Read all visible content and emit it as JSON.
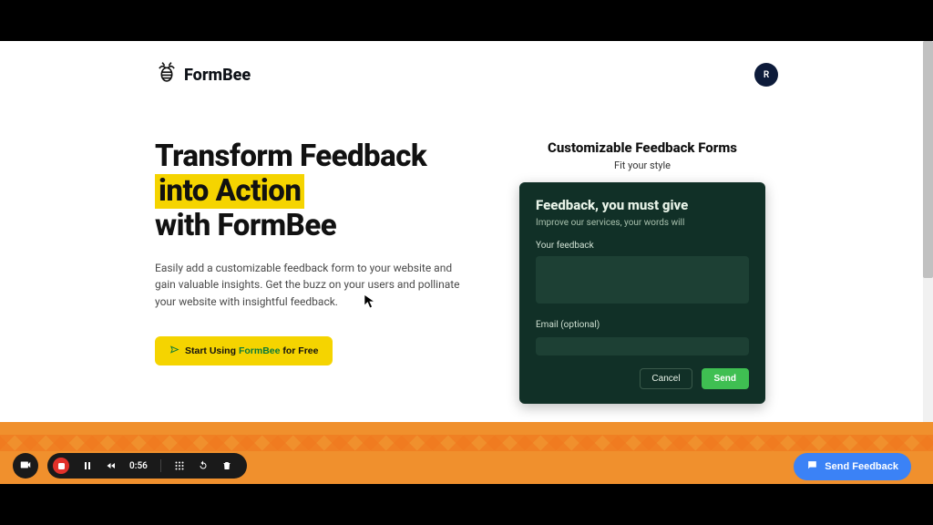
{
  "brand": {
    "name": "FormBee"
  },
  "avatar": {
    "initial": "R"
  },
  "hero": {
    "line1": "Transform Feedback",
    "highlight": "into Action",
    "line3": "with FormBee",
    "subtext": "Easily add a customizable feedback form to your website and gain valuable insights. Get the buzz on your users and pollinate your website with insightful feedback.",
    "cta_prefix": "Start Using ",
    "cta_brand": "FormBee",
    "cta_suffix": " for Free"
  },
  "panel": {
    "title": "Customizable Feedback Forms",
    "subtitle": "Fit your style"
  },
  "form": {
    "heading": "Feedback, you must give",
    "tagline": "Improve our services, your words will",
    "feedback_label": "Your feedback",
    "email_label": "Email (optional)",
    "cancel": "Cancel",
    "send": "Send"
  },
  "recorder": {
    "time": "0:56"
  },
  "feedback_button": {
    "label": "Send Feedback"
  }
}
